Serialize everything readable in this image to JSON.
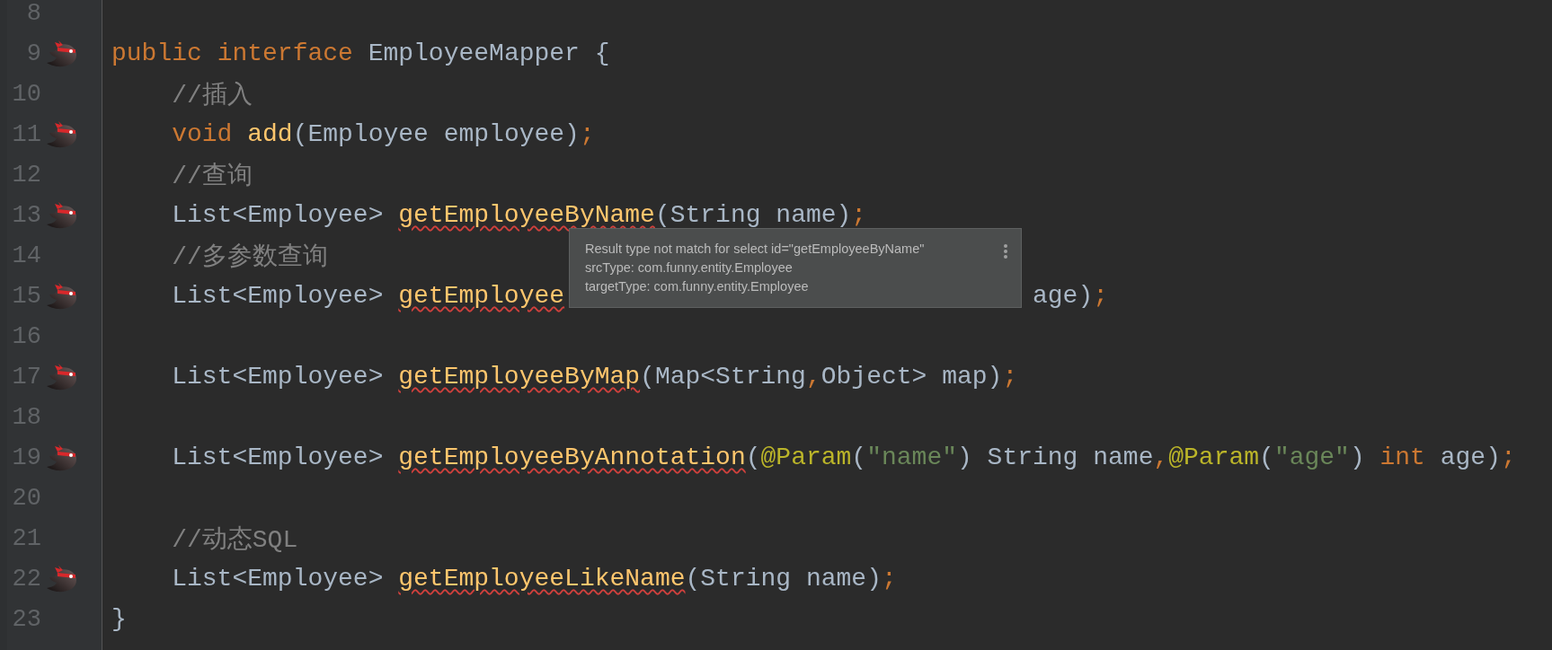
{
  "editor": {
    "lines": [
      {
        "number": "8",
        "mapper": false
      },
      {
        "number": "9",
        "mapper": true,
        "indent": false,
        "tokens": [
          {
            "text": "public ",
            "kind": "kw",
            "error": false
          },
          {
            "text": "interface ",
            "kind": "kw",
            "error": false
          },
          {
            "text": "EmployeeMapper {",
            "kind": "plain",
            "error": false
          }
        ]
      },
      {
        "number": "10",
        "mapper": false,
        "indent": true,
        "tokens": [
          {
            "text": "//插入",
            "kind": "comment",
            "error": false
          }
        ]
      },
      {
        "number": "11",
        "mapper": true,
        "indent": true,
        "tokens": [
          {
            "text": "void ",
            "kind": "kw",
            "error": false
          },
          {
            "text": "add",
            "kind": "method",
            "error": false
          },
          {
            "text": "(Employee employee)",
            "kind": "plain",
            "error": false
          },
          {
            "text": ";",
            "kind": "punct",
            "error": false
          }
        ]
      },
      {
        "number": "12",
        "mapper": false,
        "indent": true,
        "tokens": [
          {
            "text": "//查询",
            "kind": "comment",
            "error": false
          }
        ]
      },
      {
        "number": "13",
        "mapper": true,
        "indent": true,
        "tokens": [
          {
            "text": "List<Employee> ",
            "kind": "plain",
            "error": false
          },
          {
            "text": "getEmployeeByName",
            "kind": "method",
            "error": true
          },
          {
            "text": "(String name)",
            "kind": "plain",
            "error": false
          },
          {
            "text": ";",
            "kind": "punct",
            "error": false
          }
        ]
      },
      {
        "number": "14",
        "mapper": false,
        "indent": true,
        "tokens": [
          {
            "text": "//多参数查询",
            "kind": "comment",
            "error": false
          }
        ]
      },
      {
        "number": "15",
        "mapper": true,
        "indent": true,
        "tokens": [
          {
            "text": "List<Employee> ",
            "kind": "plain",
            "error": false
          },
          {
            "text": "getEmployee",
            "kind": "method",
            "error": true
          },
          {
            "kind": "covered"
          },
          {
            "text": "age)",
            "kind": "plain",
            "error": false
          },
          {
            "text": ";",
            "kind": "punct",
            "error": false
          }
        ]
      },
      {
        "number": "16",
        "mapper": false
      },
      {
        "number": "17",
        "mapper": true,
        "indent": true,
        "tokens": [
          {
            "text": "List<Employee> ",
            "kind": "plain",
            "error": false
          },
          {
            "text": "getEmployeeByMap",
            "kind": "method",
            "error": true
          },
          {
            "text": "(Map<String",
            "kind": "plain",
            "error": false
          },
          {
            "text": ",",
            "kind": "punct",
            "error": false
          },
          {
            "text": "Object> map)",
            "kind": "plain",
            "error": false
          },
          {
            "text": ";",
            "kind": "punct",
            "error": false
          }
        ]
      },
      {
        "number": "18",
        "mapper": false
      },
      {
        "number": "19",
        "mapper": true,
        "indent": true,
        "tokens": [
          {
            "text": "List<Employee> ",
            "kind": "plain",
            "error": false
          },
          {
            "text": "getEmployeeByAnnotation",
            "kind": "method",
            "error": true
          },
          {
            "text": "(",
            "kind": "plain",
            "error": false
          },
          {
            "text": "@Param",
            "kind": "annotation",
            "error": false
          },
          {
            "text": "(",
            "kind": "plain",
            "error": false
          },
          {
            "text": "\"name\"",
            "kind": "string",
            "error": false
          },
          {
            "text": ") String name",
            "kind": "plain",
            "error": false
          },
          {
            "text": ",",
            "kind": "punct",
            "error": false
          },
          {
            "text": "@Param",
            "kind": "annotation",
            "error": false
          },
          {
            "text": "(",
            "kind": "plain",
            "error": false
          },
          {
            "text": "\"age\"",
            "kind": "string",
            "error": false
          },
          {
            "text": ") ",
            "kind": "plain",
            "error": false
          },
          {
            "text": "int ",
            "kind": "kw",
            "error": false
          },
          {
            "text": "age)",
            "kind": "plain",
            "error": false
          },
          {
            "text": ";",
            "kind": "punct",
            "error": false
          }
        ]
      },
      {
        "number": "20",
        "mapper": false
      },
      {
        "number": "21",
        "mapper": false,
        "indent": true,
        "tokens": [
          {
            "text": "//动态SQL",
            "kind": "comment",
            "error": false
          }
        ]
      },
      {
        "number": "22",
        "mapper": true,
        "indent": true,
        "tokens": [
          {
            "text": "List<Employee> ",
            "kind": "plain",
            "error": false
          },
          {
            "text": "getEmployeeLikeName",
            "kind": "method",
            "error": true
          },
          {
            "text": "(String name)",
            "kind": "plain",
            "error": false
          },
          {
            "text": ";",
            "kind": "punct",
            "error": false
          }
        ]
      },
      {
        "number": "23",
        "mapper": false,
        "indent": false,
        "tokens": [
          {
            "text": "}",
            "kind": "plain",
            "error": false
          }
        ]
      }
    ]
  },
  "tooltip": {
    "lines": [
      "Result type not match for select id=\"getEmployeeByName\"",
      "srcType: com.funny.entity.Employee",
      "targetType: com.funny.entity.Employee"
    ]
  }
}
